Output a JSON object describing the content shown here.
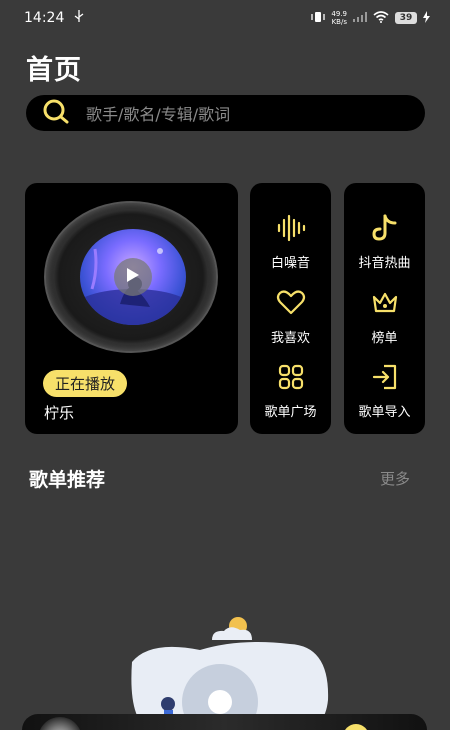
{
  "status_bar": {
    "time": "14:24",
    "usb_icon": "usb-icon",
    "net_speed_value": "49.9",
    "net_speed_unit": "KB/s",
    "battery": "39"
  },
  "header": {
    "title": "首页"
  },
  "search": {
    "placeholder": "歌手/歌名/专辑/歌词"
  },
  "player": {
    "status_badge": "正在播放",
    "song_name": "柠乐"
  },
  "menu": {
    "column1": [
      {
        "label": "白噪音",
        "icon": "sound-wave-icon"
      },
      {
        "label": "我喜欢",
        "icon": "heart-icon"
      },
      {
        "label": "歌单广场",
        "icon": "grid-icon"
      }
    ],
    "column2": [
      {
        "label": "抖音热曲",
        "icon": "tiktok-icon"
      },
      {
        "label": "榜单",
        "icon": "crown-icon"
      },
      {
        "label": "歌单导入",
        "icon": "import-icon"
      }
    ]
  },
  "section": {
    "title": "歌单推荐",
    "more": "更多"
  },
  "colors": {
    "background": "#3a3a3a",
    "card": "#000000",
    "accent_yellow": "#f7e06a",
    "muted_text": "#8a8a8a"
  }
}
